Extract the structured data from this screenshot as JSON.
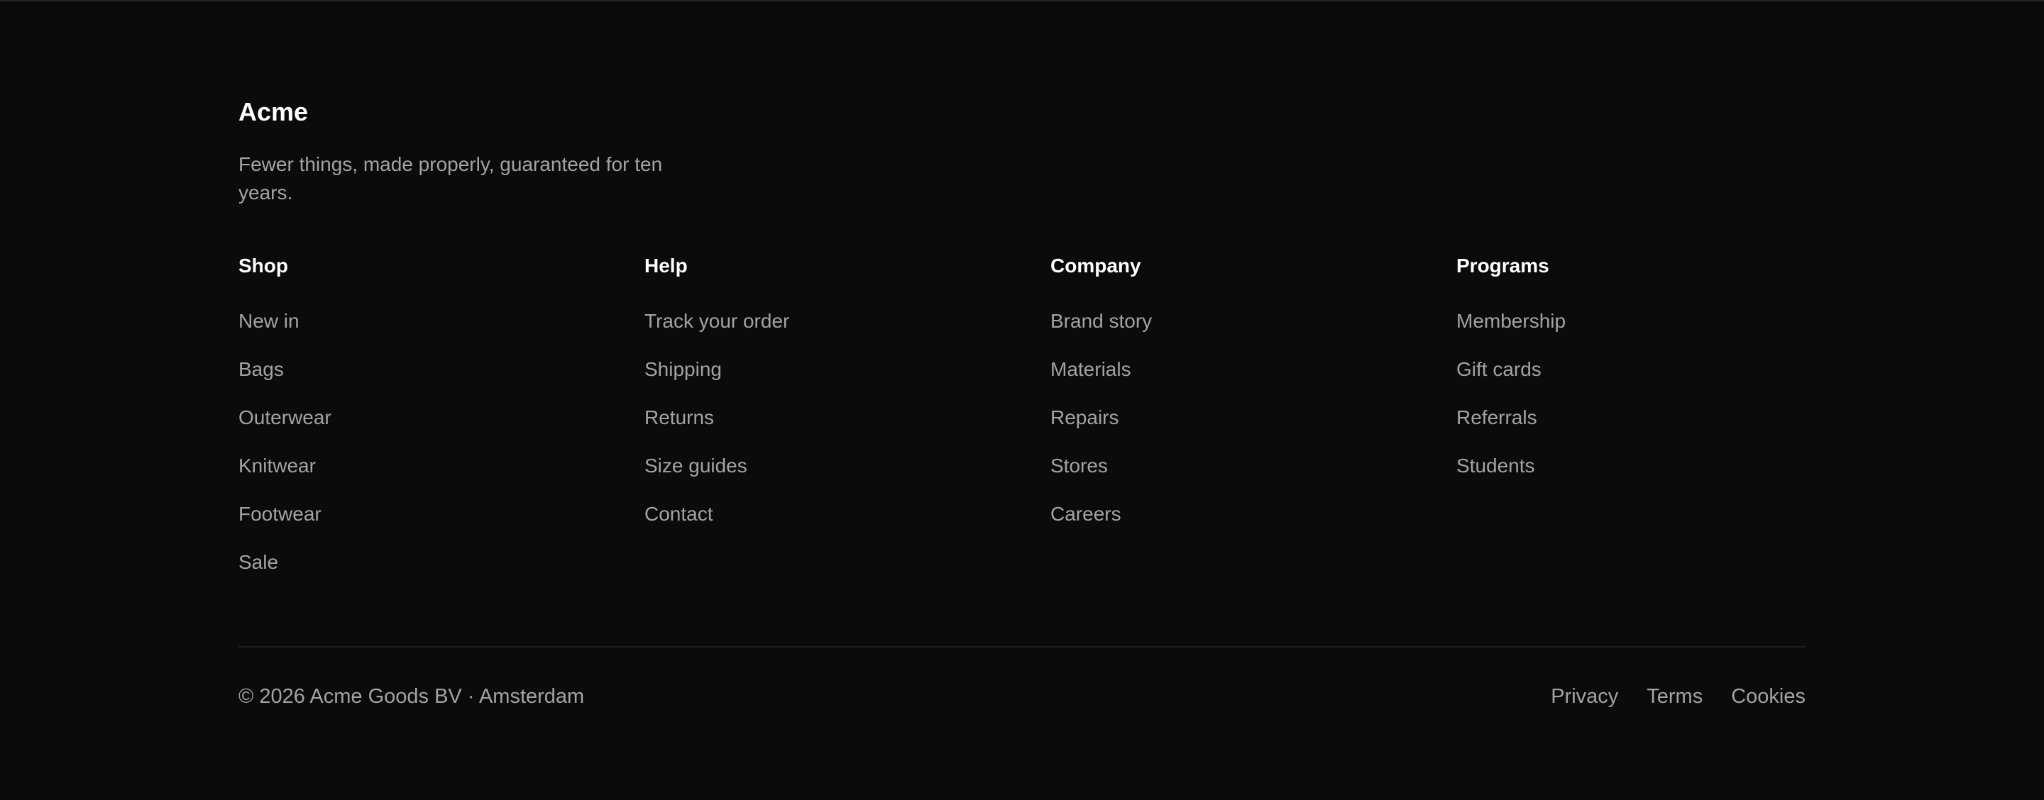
{
  "brand": {
    "name": "Acme",
    "tagline": "Fewer things, made properly, guaranteed for ten years."
  },
  "columns": [
    {
      "heading": "Shop",
      "links": [
        "New in",
        "Bags",
        "Outerwear",
        "Knitwear",
        "Footwear",
        "Sale"
      ]
    },
    {
      "heading": "Help",
      "links": [
        "Track your order",
        "Shipping",
        "Returns",
        "Size guides",
        "Contact"
      ]
    },
    {
      "heading": "Company",
      "links": [
        "Brand story",
        "Materials",
        "Repairs",
        "Stores",
        "Careers"
      ]
    },
    {
      "heading": "Programs",
      "links": [
        "Membership",
        "Gift cards",
        "Referrals",
        "Students"
      ]
    }
  ],
  "bottom": {
    "copyright": "© 2026 Acme Goods BV · Amsterdam",
    "legal_links": [
      "Privacy",
      "Terms",
      "Cookies"
    ]
  },
  "colors": {
    "background": "#0b0b0b",
    "heading": "#ffffff",
    "link": "#a3a3a3",
    "divider": "#1e1e1e"
  }
}
